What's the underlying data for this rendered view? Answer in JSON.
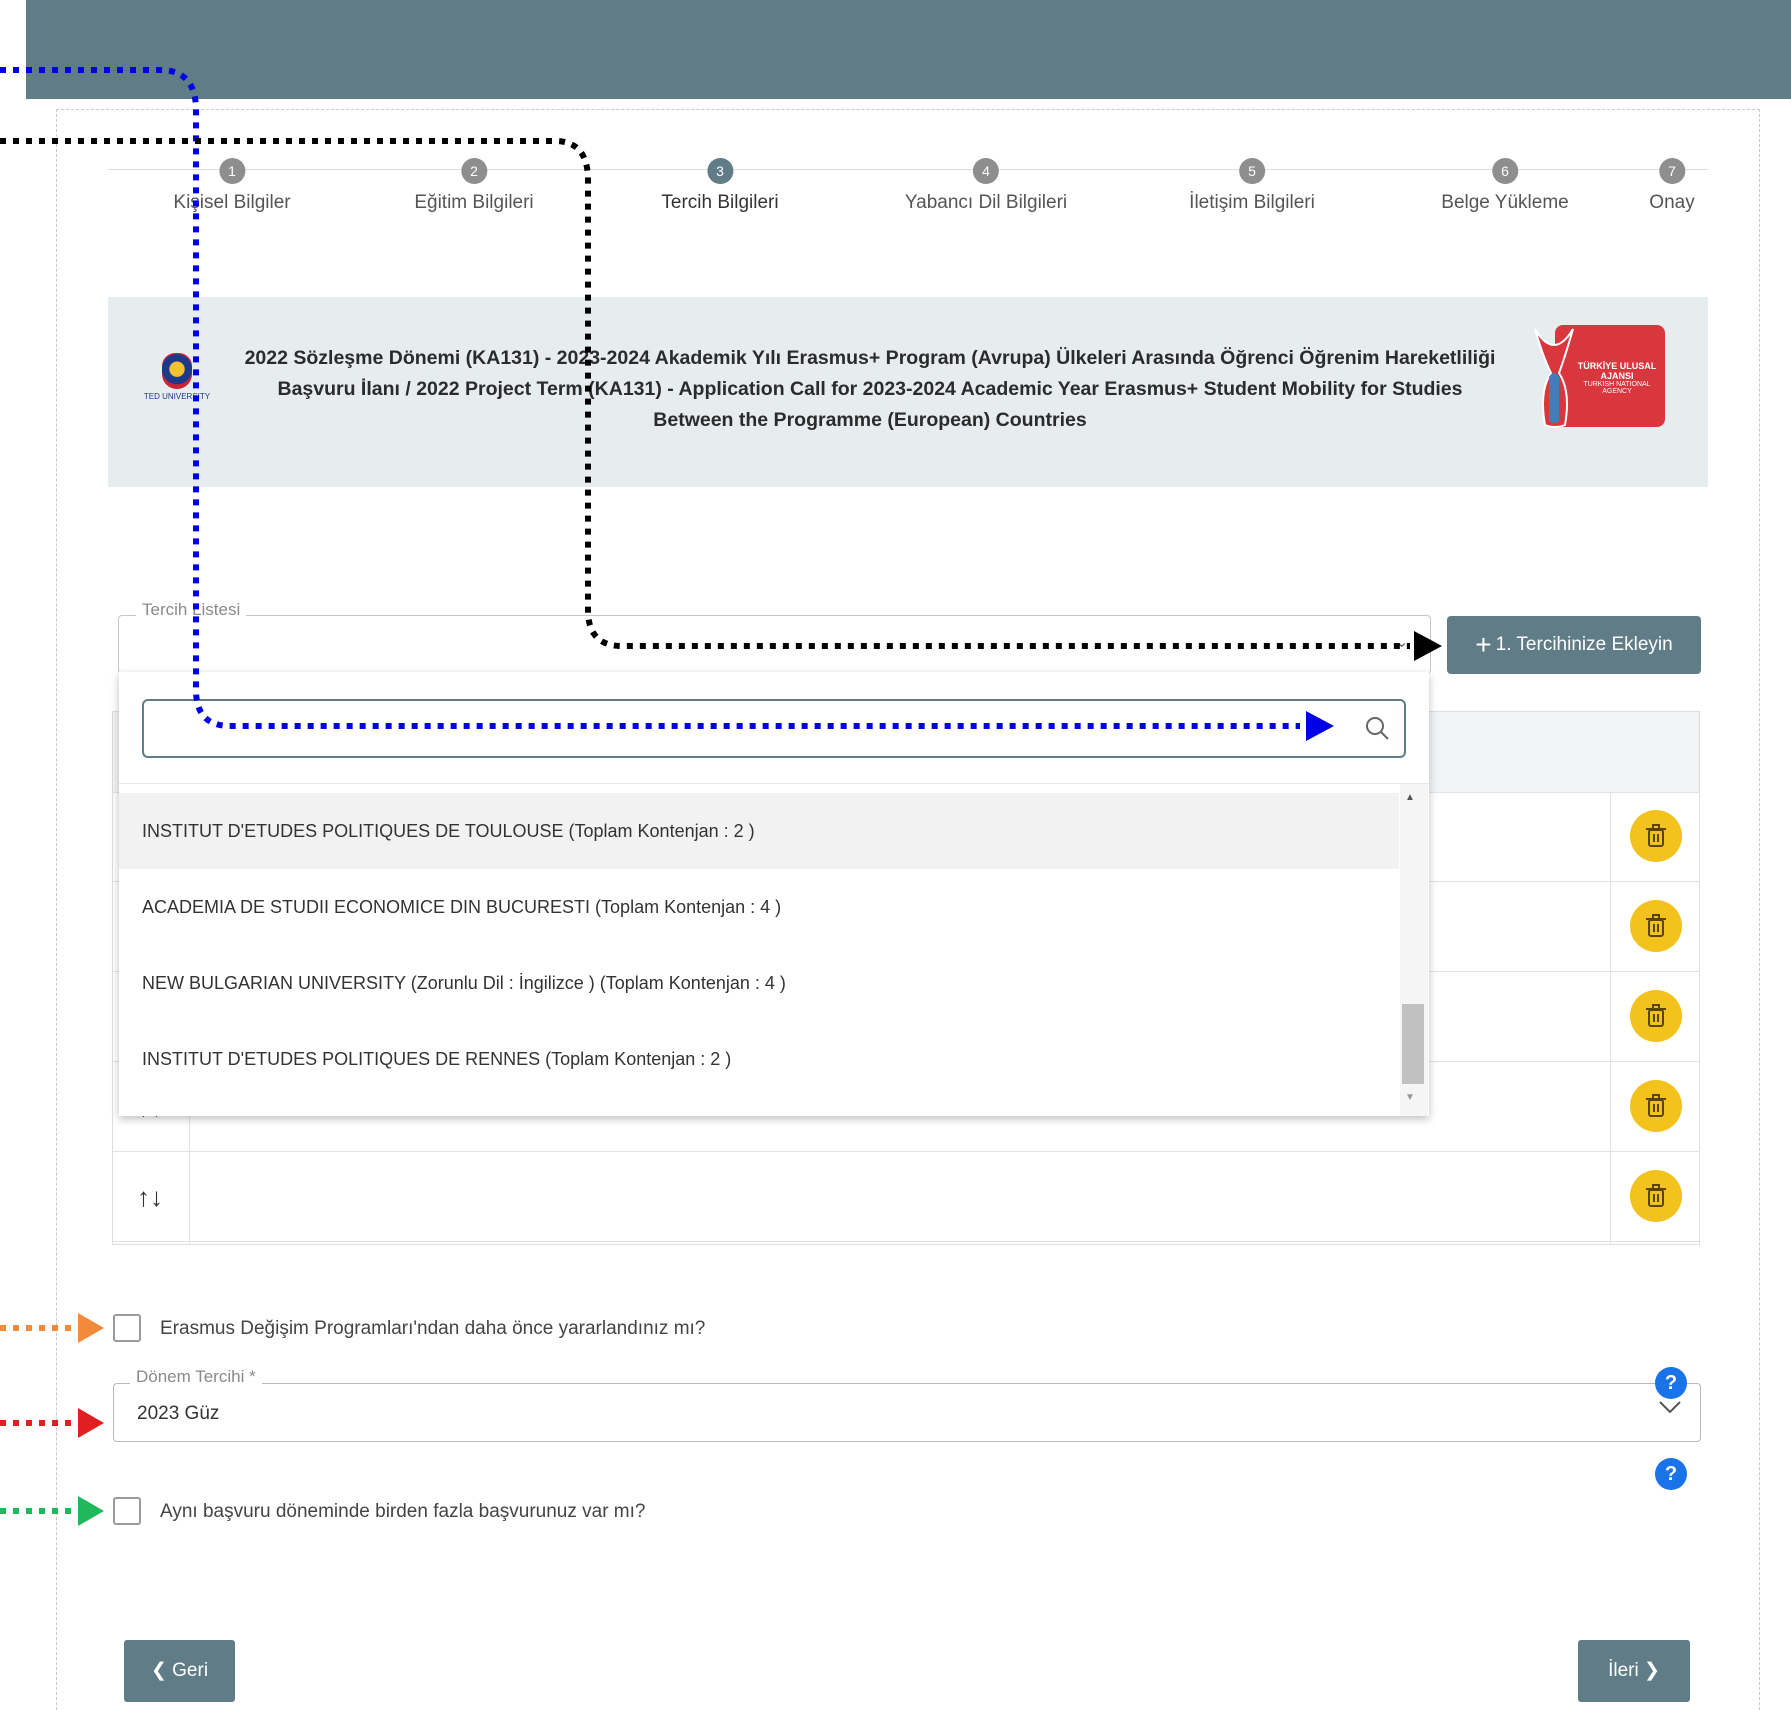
{
  "stepper": [
    {
      "num": "1",
      "label": "Kişisel Bilgiler"
    },
    {
      "num": "2",
      "label": "Eğitim Bilgileri"
    },
    {
      "num": "3",
      "label": "Tercih Bilgileri"
    },
    {
      "num": "4",
      "label": "Yabancı Dil Bilgileri"
    },
    {
      "num": "5",
      "label": "İletişim Bilgileri"
    },
    {
      "num": "6",
      "label": "Belge Yükleme"
    },
    {
      "num": "7",
      "label": "Onay"
    }
  ],
  "active_step": 3,
  "banner": {
    "title_line1": "2022 Sözleşme Dönemi (KA131) - 2023-2024 Akademik Yılı Erasmus+ Program (Avrupa) Ülkeleri Arasında Öğrenci Öğrenim Hareketliliği",
    "title_line2": "Başvuru İlanı / 2022 Project Term (KA131) - Application Call for 2023-2024 Academic Year Erasmus+ Student Mobility for Studies",
    "title_line3": "Between the Programme (European) Countries",
    "left_logo_text": "TED UNIVERSITY",
    "right_logo_text": "TÜRKİYE ULUSAL AJANSI",
    "right_logo_subtext": "TURKISH NATIONAL AGENCY"
  },
  "tercih_listesi": {
    "legend": "Tercih Listesi",
    "add_button": "1. Tercihinize Ekleyin",
    "search_placeholder": "",
    "options": [
      "INSTITUT D'ETUDES POLITIQUES DE TOULOUSE (Toplam Kontenjan : 2 )",
      "ACADEMIA DE STUDII ECONOMICE DIN BUCURESTI (Toplam Kontenjan : 4 )",
      "NEW BULGARIAN UNIVERSITY (Zorunlu Dil : İngilizce ) (Toplam Kontenjan : 4 )",
      "INSTITUT D'ETUDES POLITIQUES DE RENNES (Toplam Kontenjan : 2 )"
    ],
    "highlighted_index": 0
  },
  "table": {
    "sort_icon": "↑↓",
    "rows": 5
  },
  "erasmus_question": "Erasmus Değişim Programları'ndan daha önce yararlandınız mı?",
  "donem_tercihi": {
    "legend": "Dönem Tercihi",
    "required_mark": "*",
    "value": "2023 Güz"
  },
  "multiple_applications_question": "Aynı başvuru döneminde birden fazla başvurunuz var mı?",
  "help_icon": "?",
  "nav": {
    "back": "Geri",
    "next": "İleri"
  },
  "colors": {
    "header": "#5f7c87",
    "accent_yellow": "#f4c21c",
    "help_blue": "#1a73e8",
    "annotation_blue": "#0000e6",
    "annotation_black": "#000000",
    "annotation_orange": "#f28a3c",
    "annotation_red": "#e02020",
    "annotation_green": "#1fb85a"
  }
}
